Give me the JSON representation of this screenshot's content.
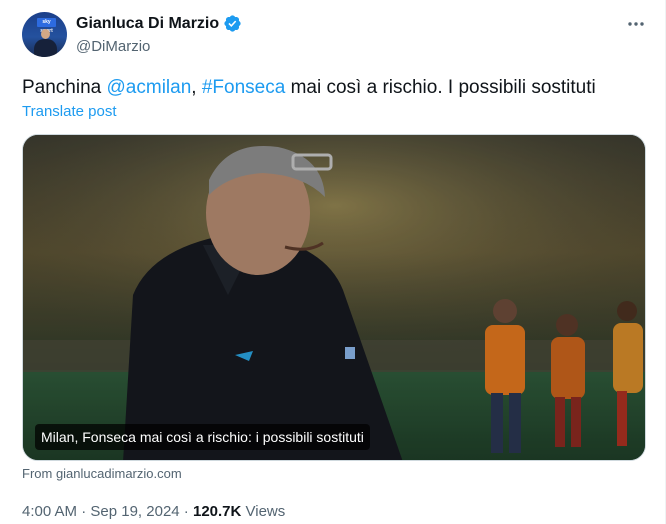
{
  "author": {
    "display_name": "Gianluca Di Marzio",
    "handle": "@DiMarzio",
    "avatar_badge": "sky sport",
    "verified": true
  },
  "tweet": {
    "text_prefix": "Panchina ",
    "mention_1": "@acmilan",
    "separator": ", ",
    "mention_2": "#Fonseca",
    "text_suffix": " mai così a rischio. I possibili sostituti",
    "translate_label": "Translate post"
  },
  "card": {
    "caption": "Milan, Fonseca mai così a rischio: i possibili sostituti",
    "source": "From gianlucadimarzio.com"
  },
  "meta": {
    "time": "4:00 AM",
    "dot_1": " · ",
    "date": "Sep 19, 2024",
    "dot_2": " · ",
    "views_count": "120.7K",
    "views_label": " Views"
  },
  "colors": {
    "accent": "#1d9bf0",
    "verified_badge": "#1d9bf0",
    "secondary_text": "#536471"
  },
  "icons": {
    "verified": "verified-badge-icon",
    "more": "more-horizontal-icon"
  }
}
